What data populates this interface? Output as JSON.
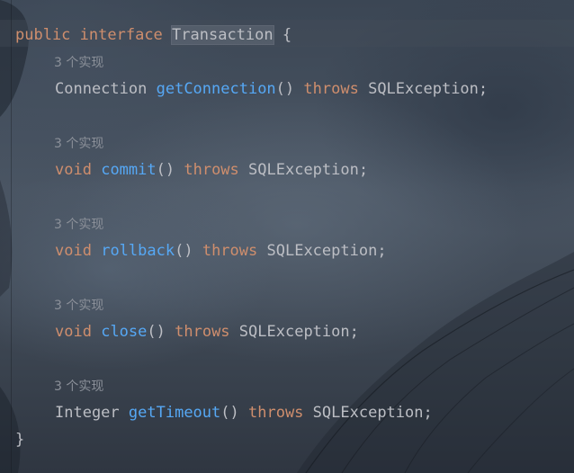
{
  "code": {
    "header": {
      "kw_public": "public",
      "kw_interface": "interface",
      "class_name": "Transaction",
      "open_brace": "{"
    },
    "methods": [
      {
        "hint": "3 个实现",
        "return_type": "Connection",
        "return_is_keyword": false,
        "name": "getConnection",
        "parens": "()",
        "kw_throws": "throws",
        "exception": "SQLException",
        "semicolon": ";"
      },
      {
        "hint": "3 个实现",
        "return_type": "void",
        "return_is_keyword": true,
        "name": "commit",
        "parens": "()",
        "kw_throws": "throws",
        "exception": "SQLException",
        "semicolon": ";"
      },
      {
        "hint": "3 个实现",
        "return_type": "void",
        "return_is_keyword": true,
        "name": "rollback",
        "parens": "()",
        "kw_throws": "throws",
        "exception": "SQLException",
        "semicolon": ";"
      },
      {
        "hint": "3 个实现",
        "return_type": "void",
        "return_is_keyword": true,
        "name": "close",
        "parens": "()",
        "kw_throws": "throws",
        "exception": "SQLException",
        "semicolon": ";"
      },
      {
        "hint": "3 个实现",
        "return_type": "Integer",
        "return_is_keyword": false,
        "name": "getTimeout",
        "parens": "()",
        "kw_throws": "throws",
        "exception": "SQLException",
        "semicolon": ";"
      }
    ],
    "close_brace": "}"
  },
  "colors": {
    "keyword": "#cf8e6d",
    "method": "#56a8f5",
    "text": "#bcbec4",
    "hint": "#8b9099"
  }
}
